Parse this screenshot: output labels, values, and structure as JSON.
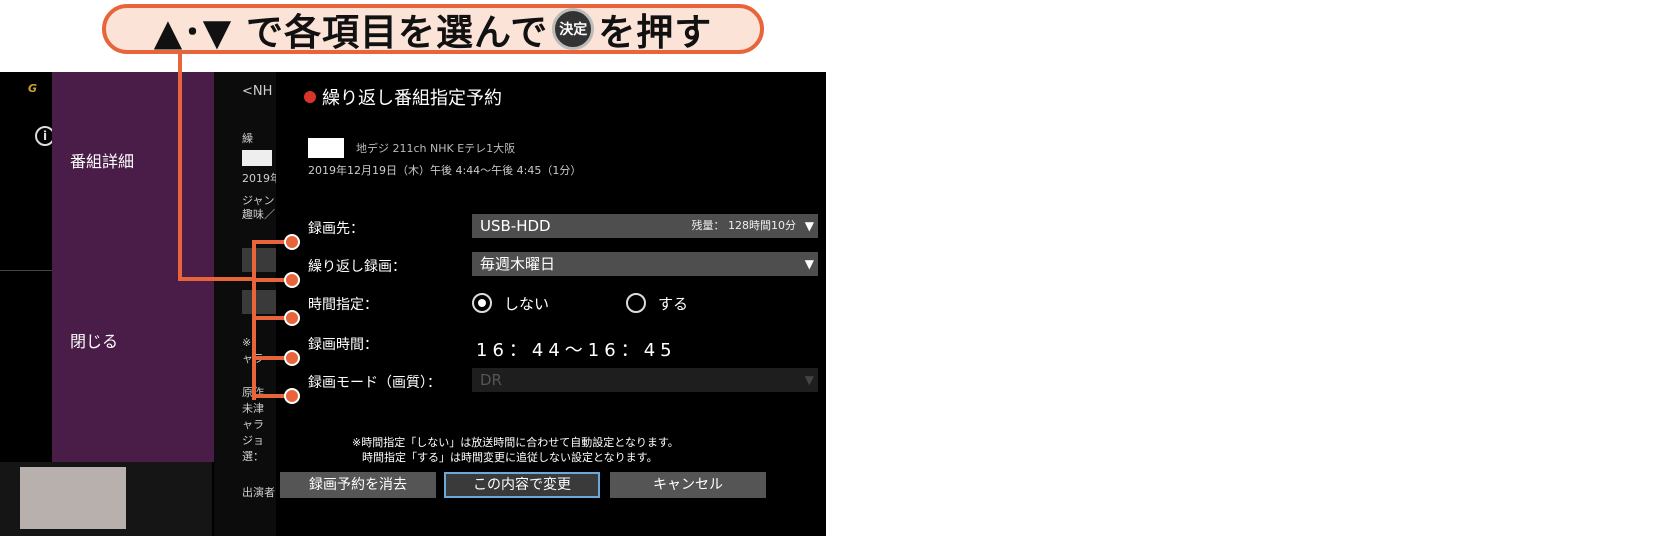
{
  "callout": {
    "text_before": "▲･▼ で各項目を選んで",
    "badge": "決定",
    "text_after": "を押す"
  },
  "sidebar": {
    "brand": "G",
    "menu": [
      "番組詳細",
      "閉じる"
    ]
  },
  "background_detail": {
    "channel_prefix": "<NH",
    "title_prefix": "繰",
    "year": "2019年",
    "genre": "ジャン",
    "hobby": "趣味／",
    "lines": [
      "※",
      "ャラ",
      "原作",
      "未津",
      "ャラ",
      "ジョ",
      "選：",
      "出演者"
    ]
  },
  "dialog": {
    "title": "繰り返し番組指定予約",
    "channel": "地デジ 211ch NHK Eテレ1大阪",
    "datetime": "2019年12月19日（木）午後 4:44〜午後 4:45（1分）",
    "rows": {
      "destination": {
        "label": "録画先：",
        "value": "USB-HDD",
        "remaining": "残量： 128時間10分"
      },
      "repeat": {
        "label": "繰り返し録画：",
        "value": "毎週木曜日"
      },
      "time_spec": {
        "label": "時間指定：",
        "option_no": "しない",
        "option_yes": "する",
        "selected": "しない"
      },
      "rec_time": {
        "label": "録画時間：",
        "value": "16：44～16：45"
      },
      "rec_mode": {
        "label": "録画モード（画質）：",
        "value": "DR"
      }
    },
    "note_line1": "※時間指定「しない」は放送時間に合わせて自動設定となります。",
    "note_line2": "時間指定「する」は時間変更に追従しない設定となります。",
    "buttons": {
      "delete": "録画予約を消去",
      "change": "この内容で変更",
      "cancel": "キャンセル"
    }
  },
  "colors": {
    "accent_orange": "#e8653c",
    "menu_purple": "#4a1d48",
    "selected_border": "#6aa9dc"
  }
}
